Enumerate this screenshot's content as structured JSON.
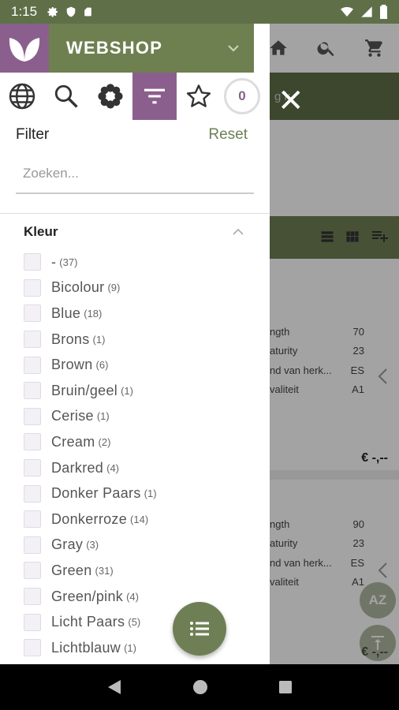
{
  "status": {
    "time": "1:15"
  },
  "app": {
    "brand": "WEBSHOP"
  },
  "toolbar": {
    "cart_count": "0"
  },
  "filter": {
    "title": "Filter",
    "reset": "Reset",
    "search_placeholder": "Zoeken...",
    "section_title": "Kleur",
    "options": [
      {
        "label": "-",
        "count": "(37)"
      },
      {
        "label": "Bicolour",
        "count": "(9)"
      },
      {
        "label": "Blue",
        "count": "(18)"
      },
      {
        "label": "Brons",
        "count": "(1)"
      },
      {
        "label": "Brown",
        "count": "(6)"
      },
      {
        "label": "Bruin/geel",
        "count": "(1)"
      },
      {
        "label": "Cerise",
        "count": "(1)"
      },
      {
        "label": "Cream",
        "count": "(2)"
      },
      {
        "label": "Darkred",
        "count": "(4)"
      },
      {
        "label": "Donker Paars",
        "count": "(1)"
      },
      {
        "label": "Donkerroze",
        "count": "(14)"
      },
      {
        "label": "Gray",
        "count": "(3)"
      },
      {
        "label": "Green",
        "count": "(31)"
      },
      {
        "label": "Green/pink",
        "count": "(4)"
      },
      {
        "label": "Licht Paars",
        "count": "(5)"
      },
      {
        "label": "Lichtblauw",
        "count": "(1)"
      }
    ]
  },
  "background": {
    "search_fragment": "g k",
    "card1": {
      "rows": [
        {
          "key": "ngth",
          "value": "70"
        },
        {
          "key": "aturity",
          "value": "23"
        },
        {
          "key": "nd van herk...",
          "value": "ES"
        },
        {
          "key": "valiteit",
          "value": "A1"
        }
      ],
      "price": "€ -,--"
    },
    "card2": {
      "rows": [
        {
          "key": "ngth",
          "value": "90"
        },
        {
          "key": "aturity",
          "value": "23"
        },
        {
          "key": "nd van herk...",
          "value": "ES"
        },
        {
          "key": "valiteit",
          "value": "A1"
        }
      ],
      "price": "€ -,--"
    }
  },
  "colors": {
    "green": "#6e8050",
    "purple": "#8b5f8d",
    "dark_green": "#5f7049"
  }
}
